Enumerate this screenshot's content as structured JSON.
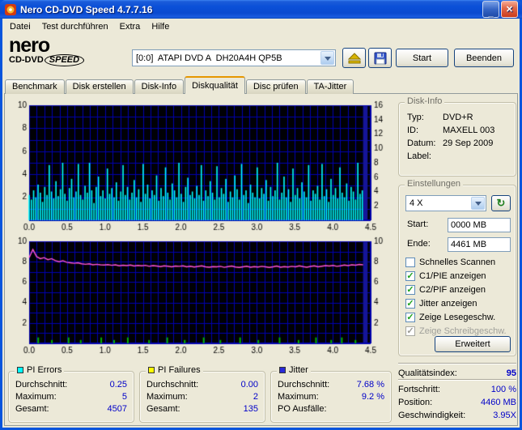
{
  "window": {
    "title": "Nero CD-DVD Speed 4.7.7.16"
  },
  "menu": {
    "items": [
      "Datei",
      "Test durchführen",
      "Extra",
      "Hilfe"
    ]
  },
  "logo": {
    "line1": "nero",
    "line2a": "CD-DVD",
    "line2b": "SPEED"
  },
  "toolbar": {
    "drive_value": "[0:0]  ATAPI DVD A  DH20A4H QP5B",
    "start_label": "Start",
    "quit_label": "Beenden"
  },
  "tabs": {
    "items": [
      "Benchmark",
      "Disk erstellen",
      "Disk-Info",
      "Diskqualität",
      "Disc prüfen",
      "TA-Jitter"
    ],
    "active": "Diskqualität"
  },
  "disk_info": {
    "title": "Disk-Info",
    "typ_label": "Typ:",
    "typ": "DVD+R",
    "id_label": "ID:",
    "id": "MAXELL 003",
    "datum_label": "Datum:",
    "datum": "29 Sep 2009",
    "label_label": "Label:",
    "label": ""
  },
  "einstellungen": {
    "title": "Einstellungen",
    "speed": "4 X",
    "start_label": "Start:",
    "start_value": "0000 MB",
    "ende_label": "Ende:",
    "ende_value": "4461 MB",
    "checkboxes": [
      {
        "label": "Schnelles Scannen",
        "mark": ""
      },
      {
        "label": "C1/PIE anzeigen",
        "mark": "✓"
      },
      {
        "label": "C2/PIF anzeigen",
        "mark": "✓"
      },
      {
        "label": "Jitter anzeigen",
        "mark": "✓"
      },
      {
        "label": "Zeige Lesegeschw.",
        "mark": "✓"
      },
      {
        "label": "Zeige Schreibgeschw.",
        "mark": "✓"
      }
    ],
    "erweitert_label": "Erweitert"
  },
  "quality": {
    "label": "Qualitätsindex:",
    "value": "95"
  },
  "progress": {
    "fortschritt_label": "Fortschritt:",
    "fortschritt": "100 %",
    "position_label": "Position:",
    "position": "4460 MB",
    "speed_label": "Geschwindigkeit:",
    "speed": "3.95X"
  },
  "stats": {
    "pi_errors": {
      "title": "PI Errors",
      "swatch_style": "background:#00ffff",
      "rows": [
        [
          "Durchschnitt:",
          "0.25"
        ],
        [
          "Maximum:",
          "5"
        ],
        [
          "Gesamt:",
          "4507"
        ]
      ]
    },
    "pi_failures": {
      "title": "PI Failures",
      "swatch_style": "background:#ffff00",
      "rows": [
        [
          "Durchschnitt:",
          "0.00"
        ],
        [
          "Maximum:",
          "2"
        ],
        [
          "Gesamt:",
          "135"
        ]
      ]
    },
    "jitter": {
      "title": "Jitter",
      "swatch_style": "background:#2a2ad8",
      "rows": [
        [
          "Durchschnitt:",
          "7.68 %"
        ],
        [
          "Maximum:",
          "9.2 %"
        ],
        [
          "PO Ausfälle:",
          ""
        ]
      ]
    }
  },
  "chart_data": [
    {
      "type": "bar",
      "name": "PI Errors (C1/PIE) vs disc position (GB)",
      "bg": "#000005",
      "grid": "#0000b0",
      "x_max": 4.5,
      "left_ticks": [
        10,
        8,
        6,
        4,
        2
      ],
      "right_ticks": [
        16,
        14,
        12,
        10,
        8,
        6,
        4,
        2
      ],
      "x_ticks": [
        "0.0",
        "0.5",
        "1.0",
        "1.5",
        "2.0",
        "2.5",
        "3.0",
        "3.5",
        "4.0",
        "4.5"
      ],
      "ylim_left": [
        0,
        10
      ],
      "ylim_right": [
        0,
        16
      ],
      "end_band": {
        "x": [
          4.4,
          4.46
        ],
        "color": "#15159a"
      },
      "series": [
        {
          "name": "C1/PIE",
          "type": "bar",
          "color": "#00ffff",
          "x_end": 4.39,
          "values": [
            2.2,
            1.8,
            2.6,
            2.0,
            3.1,
            2.4,
            1.6,
            2.9,
            2.2,
            4.8,
            2.5,
            1.9,
            3.4,
            2.1,
            2.7,
            5.0,
            2.3,
            1.7,
            2.8,
            3.6,
            2.0,
            2.5,
            4.9,
            2.2,
            1.8,
            3.0,
            2.4,
            5.0,
            2.6,
            1.5,
            2.9,
            3.8,
            2.1,
            2.6,
            1.9,
            4.5,
            2.3,
            2.8,
            2.0,
            3.3,
            1.7,
            2.5,
            4.8,
            2.2,
            2.9,
            1.8,
            2.4,
            3.5,
            2.0,
            2.7,
            1.6,
            4.9,
            2.3,
            3.1,
            1.9,
            2.6,
            2.2,
            3.9,
            1.7,
            2.8,
            2.1,
            4.6,
            2.4,
            1.8,
            3.2,
            2.6,
            2.0,
            5.0,
            2.3,
            1.6,
            2.9,
            3.7,
            2.2,
            2.5,
            1.9,
            3.0,
            2.2,
            4.8,
            1.7,
            2.6,
            2.1,
            3.4,
            2.4,
            1.8,
            4.7,
            2.0,
            2.8,
            2.3,
            3.6,
            1.6,
            2.5,
            2.0,
            3.9,
            2.7,
            1.8,
            4.9,
            2.2,
            2.6,
            1.5,
            3.1,
            2.4,
            2.0,
            4.6,
            1.9,
            2.8,
            2.3,
            3.5,
            1.7,
            2.9,
            2.1,
            2.6,
            5.0,
            1.8,
            2.4,
            3.8,
            2.0,
            2.7,
            1.6,
            4.5,
            2.2,
            2.8,
            1.9,
            3.3,
            2.5,
            2.0,
            4.8,
            1.7,
            2.6,
            2.3,
            3.0,
            1.8,
            4.9,
            2.1,
            2.7,
            1.6,
            3.6,
            2.2,
            2.8,
            1.9,
            4.6,
            2.4,
            2.0,
            3.2,
            1.7,
            2.9,
            2.5,
            1.8,
            5.0,
            2.3,
            2.6
          ]
        }
      ]
    },
    {
      "type": "mixed",
      "name": "Jitter (%) and PI Failures (C2/PIF) vs disc position (GB)",
      "bg": "#000005",
      "grid": "#0000b0",
      "x_max": 4.5,
      "left_ticks": [
        10,
        8,
        6,
        4,
        2
      ],
      "right_ticks": [
        10,
        8,
        6,
        4,
        2
      ],
      "x_ticks": [
        "0.0",
        "0.5",
        "1.0",
        "1.5",
        "2.0",
        "2.5",
        "3.0",
        "3.5",
        "4.0",
        "4.5"
      ],
      "ylim_left": [
        0,
        10
      ],
      "ylim_right": [
        0,
        10
      ],
      "end_band": {
        "x": [
          4.4,
          4.46
        ],
        "color": "#15159a"
      },
      "series": [
        {
          "name": "C2/PIF",
          "type": "bar",
          "color": "#00b400",
          "points": [
            [
              0.12,
              0.5
            ],
            [
              0.3,
              0.25
            ],
            [
              0.52,
              0.5
            ],
            [
              0.68,
              0.25
            ],
            [
              0.95,
              0.5
            ],
            [
              1.12,
              0.25
            ],
            [
              1.3,
              0.5
            ],
            [
              1.58,
              0.25
            ],
            [
              1.82,
              0.5
            ],
            [
              2.05,
              0.25
            ],
            [
              2.3,
              0.5
            ],
            [
              2.52,
              0.25
            ],
            [
              2.78,
              0.5
            ],
            [
              3.02,
              0.25
            ],
            [
              3.3,
              0.5
            ],
            [
              3.55,
              0.25
            ],
            [
              3.78,
              0.5
            ],
            [
              3.98,
              0.25
            ],
            [
              4.12,
              0.5
            ],
            [
              4.3,
              0.25
            ]
          ]
        },
        {
          "name": "Jitter",
          "type": "line",
          "color": "#ff55d4",
          "x_end": 4.4,
          "values": [
            8.4,
            9.2,
            8.5,
            8.3,
            8.4,
            8.2,
            8.3,
            8.1,
            8.0,
            8.1,
            7.95,
            7.9,
            7.85,
            7.9,
            7.8,
            7.75,
            7.8,
            7.7,
            7.75,
            7.7,
            7.68,
            7.72,
            7.65,
            7.7,
            7.6,
            7.66,
            7.62,
            7.68,
            7.58,
            7.64,
            7.6,
            7.65,
            7.55,
            7.62,
            7.58,
            7.52,
            7.6,
            7.56,
            7.5,
            7.58,
            7.55,
            7.6,
            7.5,
            7.56,
            7.48,
            7.54,
            7.6,
            7.5,
            7.46,
            7.52,
            7.5,
            7.55,
            7.45,
            7.52,
            7.58,
            7.48,
            7.44,
            7.5,
            7.56,
            7.46,
            7.52,
            7.48,
            7.55,
            7.5,
            7.44,
            7.5,
            7.58,
            7.46,
            7.52,
            7.48,
            7.55,
            7.5,
            7.6,
            7.52,
            7.46,
            7.54,
            7.6,
            7.5,
            7.56,
            7.62,
            7.58,
            7.64,
            7.55,
            7.6,
            7.68,
            7.62,
            7.7,
            7.66,
            7.74,
            7.7
          ]
        }
      ]
    }
  ]
}
